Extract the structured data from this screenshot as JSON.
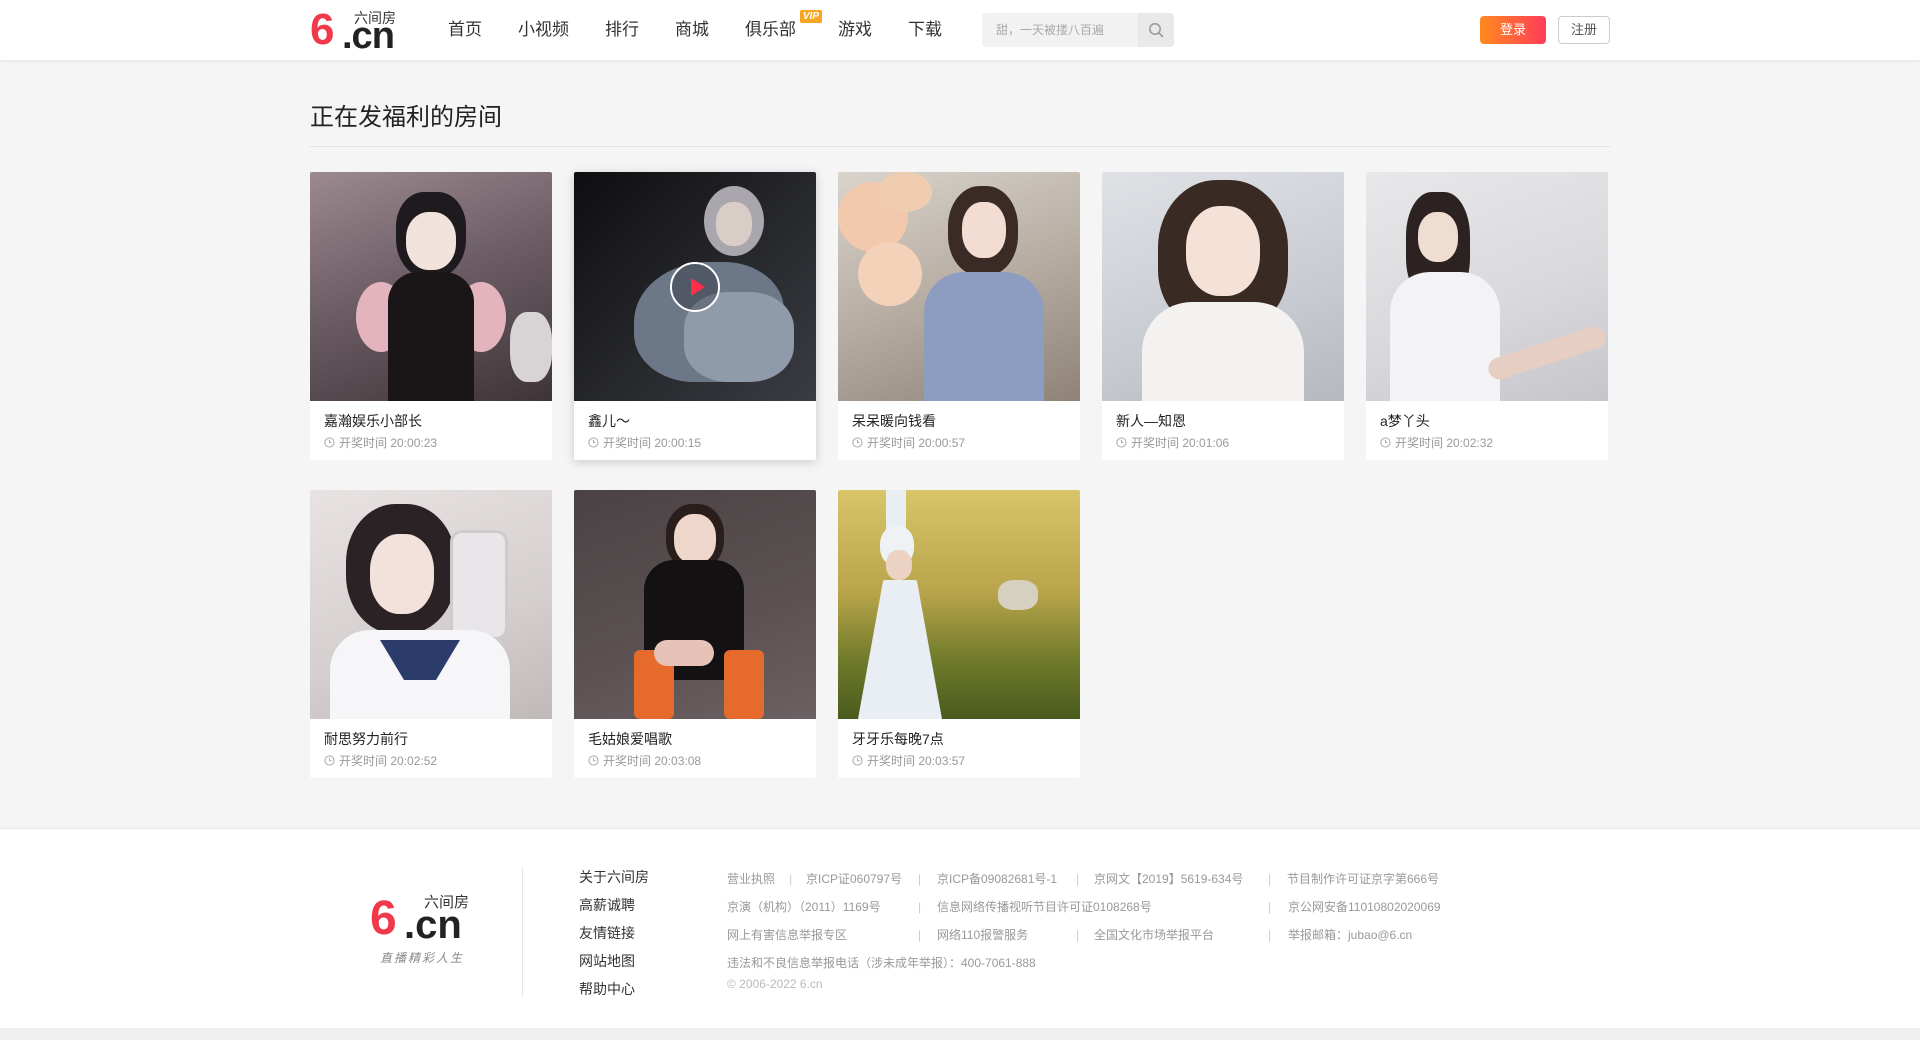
{
  "header": {
    "logo_text": "六间房",
    "logo_six": "6",
    "logo_cn": ".cn",
    "nav": [
      "首页",
      "小视频",
      "排行",
      "商城",
      "俱乐部",
      "游戏",
      "下载"
    ],
    "vip_badge": "VIP",
    "search_placeholder": "甜，一天被搂八百遍",
    "login": "登录",
    "register": "注册"
  },
  "main": {
    "title": "正在发福利的房间",
    "time_prefix": "开奖时间",
    "cards": [
      {
        "name": "嘉瀚娱乐⁠小部长⁠",
        "time": "开奖时间 20:00:23"
      },
      {
        "name": "鑫儿～",
        "time": "开奖时间 20:00:15"
      },
      {
        "name": "呆呆暖向钱看⁠",
        "time": "开奖时间 20:00:57"
      },
      {
        "name": "新人—知恩",
        "time": "开奖时间 20:01:06"
      },
      {
        "name": "a梦丫头",
        "time": "开奖时间 20:02:32"
      },
      {
        "name": "耐思努力前行⁠",
        "time": "开奖时间 20:02:52"
      },
      {
        "name": "毛姑娘⁠爱唱歌",
        "time": "开奖时间 20:03:08"
      },
      {
        "name": "牙牙乐⁠每晚7点",
        "time": "开奖时间 20:03:57"
      }
    ]
  },
  "footer": {
    "logo_text": "六间房",
    "logo_six": "6",
    "logo_cn": ".cn",
    "slogan": "直播精彩人生",
    "links": [
      "关于六间房",
      "高薪诚聘",
      "友情链接",
      "网站地图",
      "帮助中心"
    ],
    "info": {
      "r1": [
        "营业执照",
        "京ICP证060797号",
        "京ICP备09082681号-1",
        "京网文【2019】5619-634号",
        "节目制作许可证京字第666号"
      ],
      "r2": [
        "京演（机构）（2011）1169号",
        "信息网络传播视听节目许可证0108268号",
        "京公网安备11010802020069"
      ],
      "r3": [
        "网上有害信息举报专区",
        "网络110报警服务",
        "全国文化市场举报平台",
        "举报邮箱：jubao@6.cn"
      ],
      "r4": "违法和不良信息举报电话（涉未成年举报）：400-7061-888",
      "copyright": "© 2006-2022 6.cn"
    }
  },
  "colors": {
    "accent": "#ff3c5a",
    "accent_orange": "#ff8a1e",
    "vip": "#f5a623",
    "play": "#ff2f48"
  },
  "icons": [
    "search-icon",
    "clock-icon",
    "play-icon"
  ]
}
